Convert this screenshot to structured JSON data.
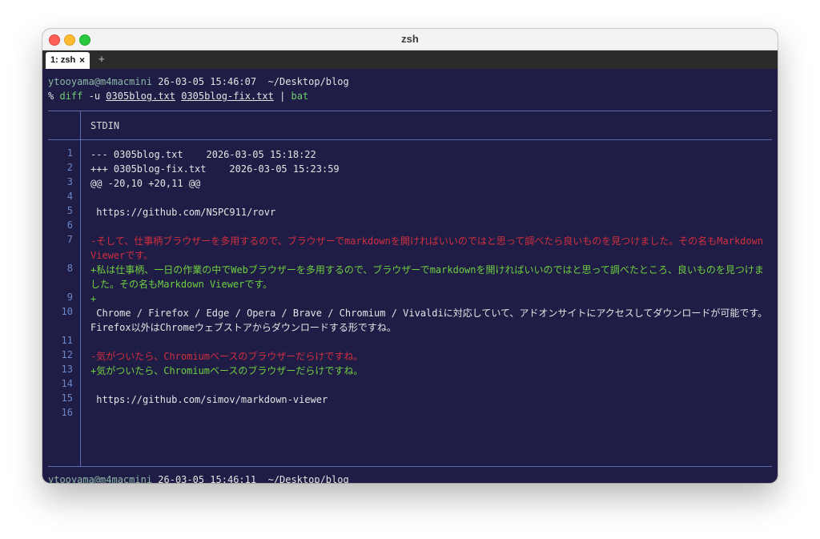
{
  "window": {
    "title": "zsh"
  },
  "tabs": [
    {
      "label": "1: zsh",
      "close": "×"
    }
  ],
  "tab_add": "+",
  "prompt1": {
    "user_host": "ytooyama@m4macmini",
    "timestamp": "26-03-05 15:46:07",
    "path": "~/Desktop/blog"
  },
  "command": {
    "prompt_char": "%",
    "cmd": "diff",
    "flag": "-u",
    "file1": "0305blog.txt",
    "file2": "0305blog-fix.txt",
    "pipe": "|",
    "pipe_cmd": "bat"
  },
  "bat": {
    "header": "STDIN",
    "lines": [
      {
        "num": "1",
        "type": "meta",
        "text": "--- 0305blog.txt    2026-03-05 15:18:22"
      },
      {
        "num": "2",
        "type": "meta",
        "text": "+++ 0305blog-fix.txt    2026-03-05 15:23:59"
      },
      {
        "num": "3",
        "type": "meta",
        "text": "@@ -20,10 +20,11 @@"
      },
      {
        "num": "4",
        "type": "ctx",
        "text": ""
      },
      {
        "num": "5",
        "type": "ctx",
        "text": " https://github.com/NSPC911/rovr"
      },
      {
        "num": "6",
        "type": "ctx",
        "text": ""
      },
      {
        "num": "7",
        "type": "del",
        "text": "-そして、仕事柄ブラウザーを多用するので、ブラウザーでmarkdownを開ければいいのではと思って調べたら良いものを見つけました。その名もMarkdown Viewerです。"
      },
      {
        "num": "8",
        "type": "add",
        "text": "+私は仕事柄、一日の作業の中でWebブラウザーを多用するので、ブラウザーでmarkdownを開ければいいのではと思って調べたところ、良いものを見つけました。その名もMarkdown Viewerです。"
      },
      {
        "num": "9",
        "type": "add",
        "text": "+"
      },
      {
        "num": "10",
        "type": "ctx",
        "text": " Chrome / Firefox / Edge / Opera / Brave / Chromium / Vivaldiに対応していて、アドオンサイトにアクセスしてダウンロードが可能です。Firefox以外はChromeウェブストアからダウンロードする形ですね。"
      },
      {
        "num": "11",
        "type": "ctx",
        "text": ""
      },
      {
        "num": "12",
        "type": "del",
        "text": "-気がついたら、Chromiumベースのブラウザーだらけですね。"
      },
      {
        "num": "13",
        "type": "add",
        "text": "+気がついたら、Chromiumベースのブラウザーだらけですね。"
      },
      {
        "num": "14",
        "type": "ctx",
        "text": ""
      },
      {
        "num": "15",
        "type": "ctx",
        "text": " https://github.com/simov/markdown-viewer"
      },
      {
        "num": "16",
        "type": "ctx",
        "text": ""
      }
    ]
  },
  "prompt2": {
    "user_host": "ytooyama@m4macmini",
    "timestamp": "26-03-05 15:46:11",
    "path": "~/Desktop/blog",
    "prompt_char": "%"
  },
  "colors": {
    "terminal_bg": "#1f1d45",
    "deleted": "#d12f3e",
    "added": "#6fcf3f",
    "rule": "#5a6bb0",
    "cursor": "#f0c43a"
  }
}
